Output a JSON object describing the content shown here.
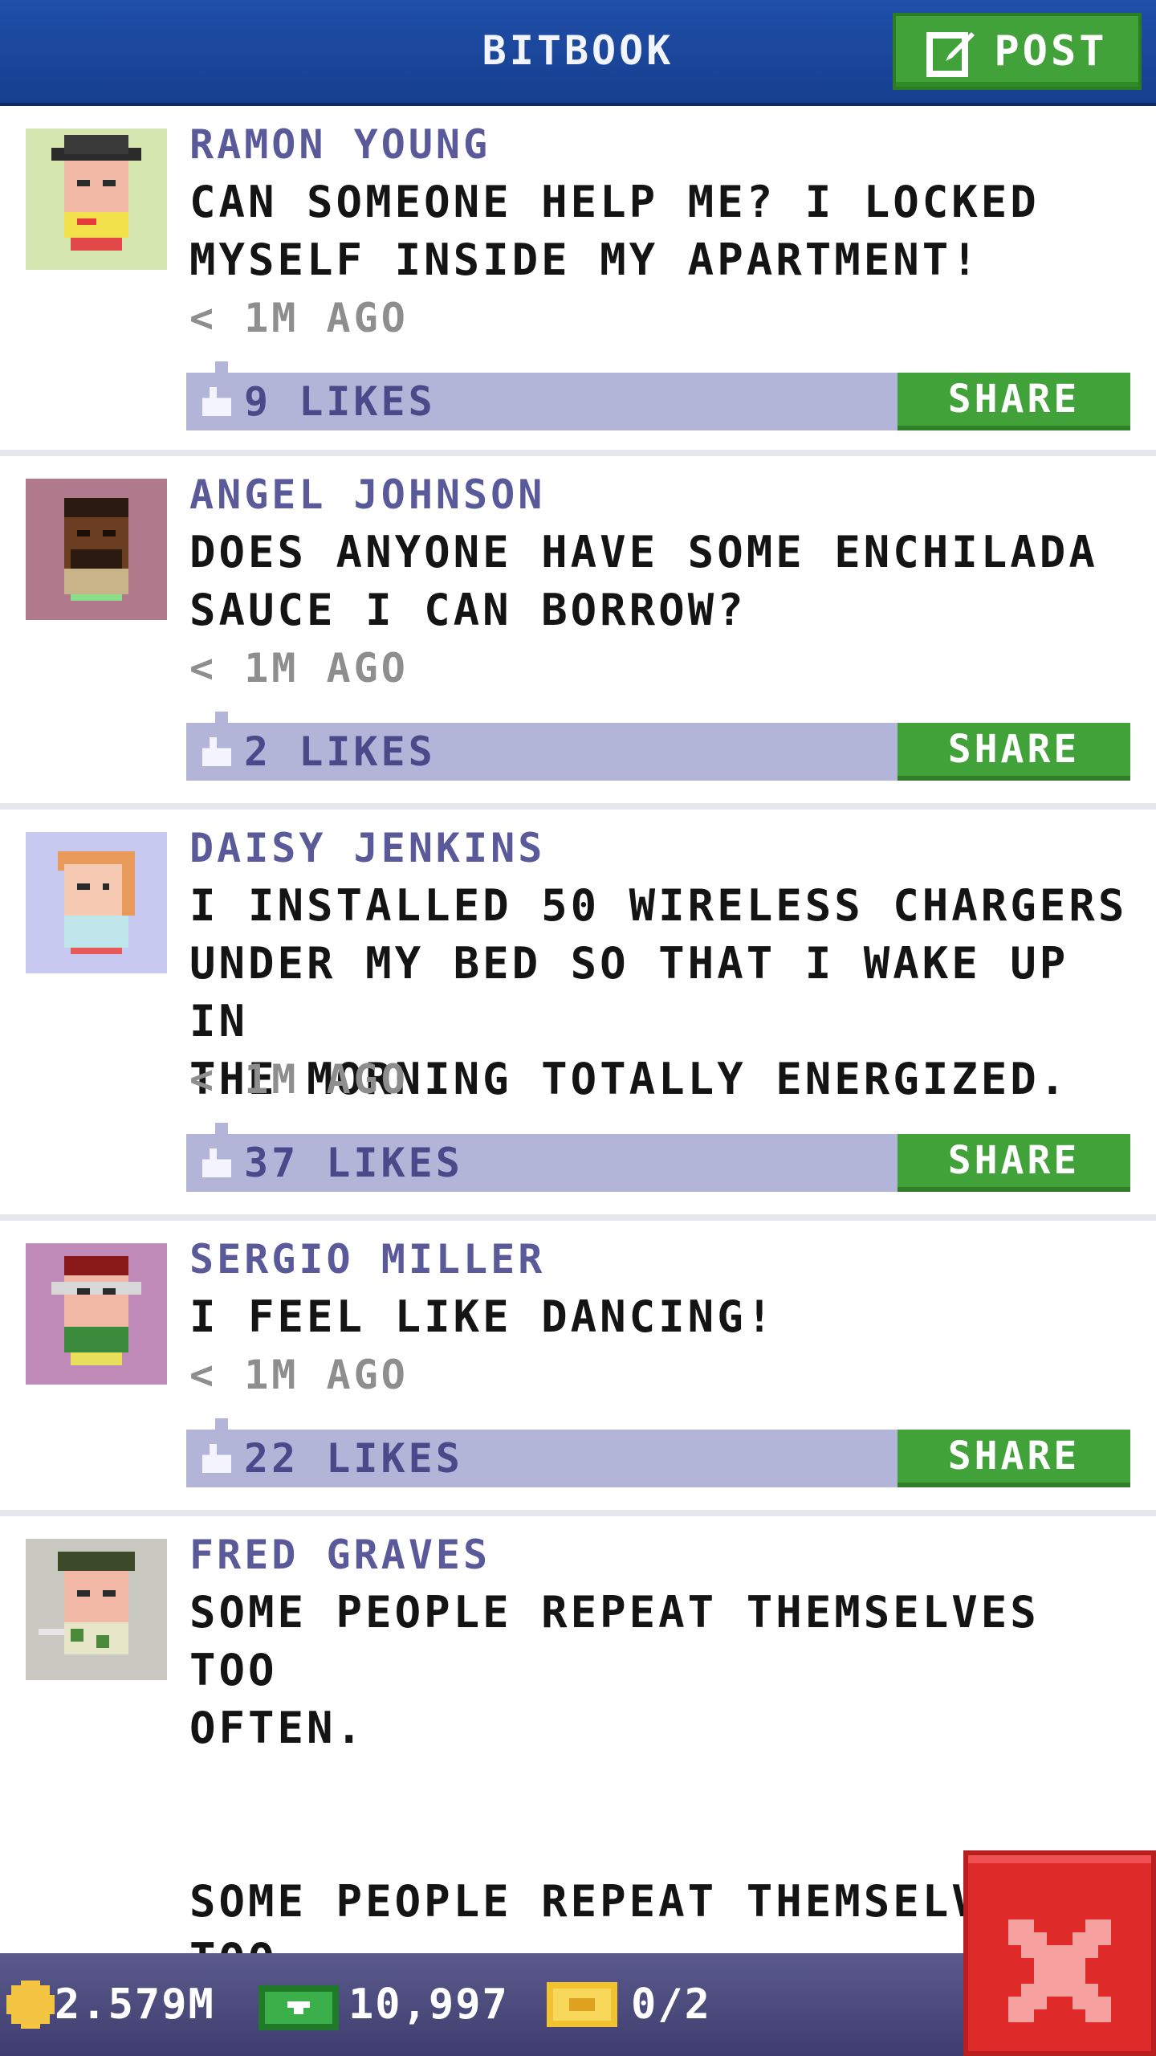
{
  "header": {
    "title": "BITBOOK",
    "post_label": "POST"
  },
  "posts": [
    {
      "name": "RAMON YOUNG",
      "message": "CAN SOMEONE HELP ME? I LOCKED\nMYSELF INSIDE MY APARTMENT!",
      "time": "< 1M AGO",
      "likes": "9 LIKES",
      "share": "SHARE",
      "avatar_bg": "#d6e6b0"
    },
    {
      "name": "ANGEL JOHNSON",
      "message": "DOES ANYONE HAVE SOME ENCHILADA\nSAUCE I CAN BORROW?",
      "time": "< 1M AGO",
      "likes": "2 LIKES",
      "share": "SHARE",
      "avatar_bg": "#b07a8c"
    },
    {
      "name": "DAISY JENKINS",
      "message": "I INSTALLED 50 WIRELESS CHARGERS\nUNDER MY BED SO THAT I WAKE UP IN\nTHE MORNING TOTALLY ENERGIZED.",
      "time": "< 1M AGO",
      "likes": "37 LIKES",
      "share": "SHARE",
      "avatar_bg": "#c7c9f0"
    },
    {
      "name": "SERGIO MILLER",
      "message": "I FEEL LIKE DANCING!",
      "time": "< 1M AGO",
      "likes": "22 LIKES",
      "share": "SHARE",
      "avatar_bg": "#c08ab8"
    },
    {
      "name": "FRED GRAVES",
      "message": "SOME PEOPLE REPEAT THEMSELVES TOO\nOFTEN.\n\n\nSOME PEOPLE REPEAT THEMSELVES TOO\nOFTEN.",
      "avatar_bg": "#c8c8c0"
    }
  ],
  "bottom_bar": {
    "coins": "2.579M",
    "bux": "10,997",
    "tickets": "0/2"
  },
  "colors": {
    "header_blue": "#1f4fa8",
    "button_green": "#42a23a",
    "like_bar": "#b3b5d8",
    "name_purple": "#5a5a9a",
    "close_red": "#e02b2b"
  },
  "icons": [
    "edit-icon",
    "thumbs-up-icon",
    "coin-icon",
    "bux-icon",
    "ticket-icon",
    "close-icon"
  ]
}
